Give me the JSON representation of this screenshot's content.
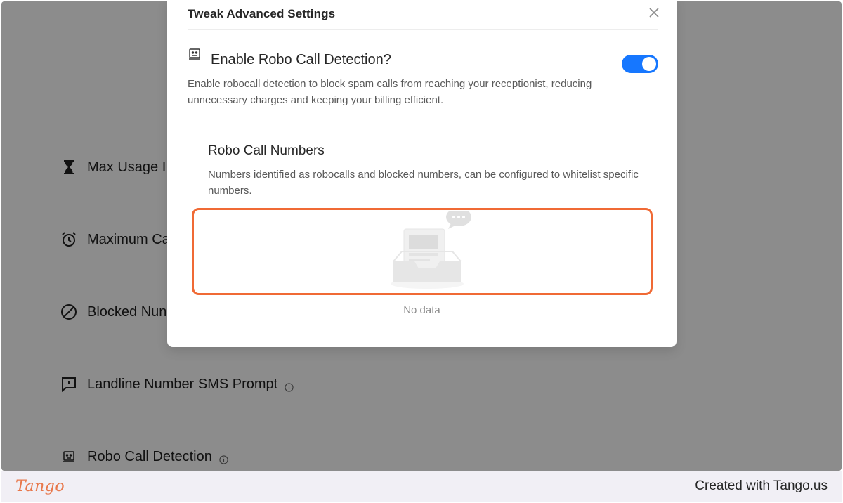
{
  "background": {
    "settings": [
      {
        "label": "Max Usage I",
        "icon": "hourglass-icon"
      },
      {
        "label": "Maximum Ca",
        "icon": "alarm-clock-icon"
      },
      {
        "label": "Blocked Nun",
        "icon": "blocked-icon"
      },
      {
        "label": "Landline Number SMS Prompt",
        "icon": "message-alert-icon"
      },
      {
        "label": "Robo Call Detection",
        "icon": "robot-icon"
      }
    ]
  },
  "modal": {
    "title": "Tweak Advanced Settings",
    "close_icon": "close-icon",
    "option": {
      "icon": "robot-icon",
      "title": "Enable Robo Call Detection?",
      "enabled": true,
      "description": "Enable robocall detection to block spam calls from reaching your receptionist, reducing unnecessary charges and keeping your billing efficient."
    },
    "section": {
      "title": "Robo Call Numbers",
      "description": "Numbers identified as robocalls and blocked numbers, can be configured to whitelist specific numbers."
    },
    "empty_text": "No data"
  },
  "footer": {
    "brand": "Tango",
    "credit": "Created with Tango.us"
  },
  "colors": {
    "accent": "#1677ff",
    "highlight": "#f06a35",
    "brand": "#e8774a"
  }
}
